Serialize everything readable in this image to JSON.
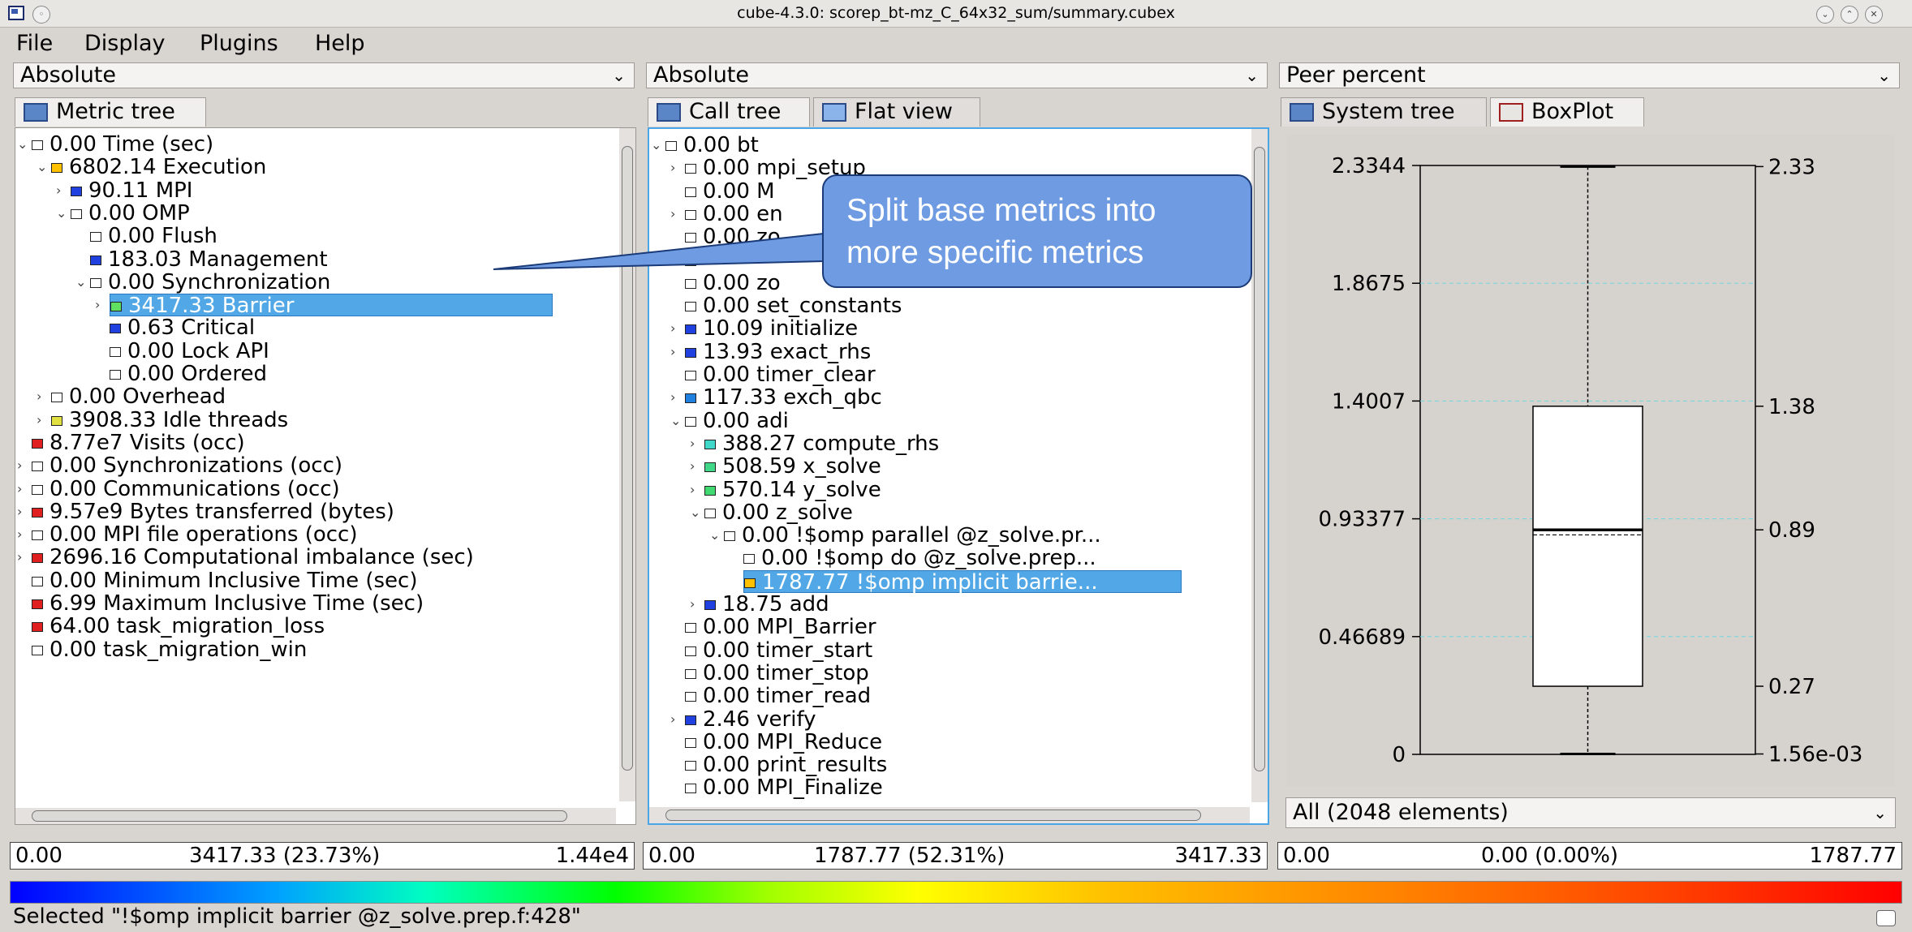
{
  "window": {
    "title": "cube-4.3.0: scorep_bt-mz_C_64x32_sum/summary.cubex"
  },
  "menu": {
    "file": "File",
    "display": "Display",
    "plugins": "Plugins",
    "help": "Help"
  },
  "left": {
    "combo": "Absolute",
    "tab": "Metric tree",
    "rows": [
      {
        "label": "0.00 Time (sec)",
        "color": "#ffffff"
      },
      {
        "label": "6802.14 Execution",
        "color": "#ffc000"
      },
      {
        "label": "90.11 MPI",
        "color": "#2040e0"
      },
      {
        "label": "0.00 OMP",
        "color": "#ffffff"
      },
      {
        "label": "0.00 Flush",
        "color": "#ffffff"
      },
      {
        "label": "183.03 Management",
        "color": "#2040e0"
      },
      {
        "label": "0.00 Synchronization",
        "color": "#ffffff"
      },
      {
        "label": "3417.33 Barrier",
        "color": "#60e060"
      },
      {
        "label": "0.63 Critical",
        "color": "#2040e0"
      },
      {
        "label": "0.00 Lock API",
        "color": "#ffffff"
      },
      {
        "label": "0.00 Ordered",
        "color": "#ffffff"
      },
      {
        "label": "0.00 Overhead",
        "color": "#ffffff"
      },
      {
        "label": "3908.33 Idle threads",
        "color": "#e0e040"
      },
      {
        "label": "8.77e7 Visits (occ)",
        "color": "#e02020"
      },
      {
        "label": "0.00 Synchronizations (occ)",
        "color": "#ffffff"
      },
      {
        "label": "0.00 Communications (occ)",
        "color": "#ffffff"
      },
      {
        "label": "9.57e9 Bytes transferred (bytes)",
        "color": "#e02020"
      },
      {
        "label": "0.00 MPI file operations (occ)",
        "color": "#ffffff"
      },
      {
        "label": "2696.16 Computational imbalance (sec)",
        "color": "#e02020"
      },
      {
        "label": "0.00 Minimum Inclusive Time (sec)",
        "color": "#ffffff"
      },
      {
        "label": "6.99 Maximum Inclusive Time (sec)",
        "color": "#e02020"
      },
      {
        "label": "64.00 task_migration_loss",
        "color": "#e02020"
      },
      {
        "label": "0.00 task_migration_win",
        "color": "#ffffff"
      }
    ],
    "value_min": "0.00",
    "value_sel": "3417.33 (23.73%)",
    "value_max": "1.44e4"
  },
  "middle": {
    "combo": "Absolute",
    "tab_call": "Call tree",
    "tab_flat": "Flat view",
    "rows": [
      {
        "label": "0.00 bt",
        "color": "#ffffff"
      },
      {
        "label": "0.00 mpi_setup",
        "color": "#ffffff"
      },
      {
        "label": "0.00 M",
        "color": "#ffffff"
      },
      {
        "label": "0.00 en",
        "color": "#ffffff"
      },
      {
        "label": "0.00 zo",
        "color": "#ffffff"
      },
      {
        "label": "",
        "color": "#ffffff"
      },
      {
        "label": "0.00 zo",
        "color": "#ffffff"
      },
      {
        "label": "0.00 set_constants",
        "color": "#ffffff"
      },
      {
        "label": "10.09 initialize",
        "color": "#2040e0"
      },
      {
        "label": "13.93 exact_rhs",
        "color": "#2040e0"
      },
      {
        "label": "0.00 timer_clear",
        "color": "#ffffff"
      },
      {
        "label": "117.33 exch_qbc",
        "color": "#2080e0"
      },
      {
        "label": "0.00 adi",
        "color": "#ffffff"
      },
      {
        "label": "388.27 compute_rhs",
        "color": "#40d8c8"
      },
      {
        "label": "508.59 x_solve",
        "color": "#40d888"
      },
      {
        "label": "570.14 y_solve",
        "color": "#40d870"
      },
      {
        "label": "0.00 z_solve",
        "color": "#ffffff"
      },
      {
        "label": "0.00 !$omp parallel @z_solve.pr...",
        "color": "#ffffff"
      },
      {
        "label": "0.00 !$omp do @z_solve.prep...",
        "color": "#ffffff"
      },
      {
        "label": "1787.77 !$omp implicit barrie...",
        "color": "#ffc000"
      },
      {
        "label": "18.75 add",
        "color": "#2040e0"
      },
      {
        "label": "0.00 MPI_Barrier",
        "color": "#ffffff"
      },
      {
        "label": "0.00 timer_start",
        "color": "#ffffff"
      },
      {
        "label": "0.00 timer_stop",
        "color": "#ffffff"
      },
      {
        "label": "0.00 timer_read",
        "color": "#ffffff"
      },
      {
        "label": "2.46 verify",
        "color": "#2040e0"
      },
      {
        "label": "0.00 MPI_Reduce",
        "color": "#ffffff"
      },
      {
        "label": "0.00 print_results",
        "color": "#ffffff"
      },
      {
        "label": "0.00 MPI_Finalize",
        "color": "#ffffff"
      }
    ],
    "value_min": "0.00",
    "value_sel": "1787.77 (52.31%)",
    "value_max": "3417.33"
  },
  "right": {
    "combo": "Peer percent",
    "tab_system": "System tree",
    "tab_box": "BoxPlot",
    "selector": "All (2048 elements)",
    "value_min": "0.00",
    "value_sel": "0.00 (0.00%)",
    "value_max": "1787.77"
  },
  "callout": {
    "line1": "Split base metrics into",
    "line2": "more specific metrics"
  },
  "status": "Selected \"!$omp implicit barrier @z_solve.prep.f:428\"",
  "chart_data": {
    "type": "boxplot",
    "left_ticks": [
      "2.3344",
      "1.8675",
      "1.4007",
      "0.93377",
      "0.46689",
      "0"
    ],
    "left_tick_values": [
      2.3344,
      1.8675,
      1.4007,
      0.93377,
      0.46689,
      0
    ],
    "right_ticks": [
      "2.33",
      "1.38",
      "0.89",
      "0.27",
      "1.56e-03"
    ],
    "ylim": [
      0,
      2.3344
    ],
    "min": 0.00156,
    "q1": 0.27,
    "median": 0.89,
    "mean": 0.87,
    "q3": 1.38,
    "max": 2.33
  }
}
